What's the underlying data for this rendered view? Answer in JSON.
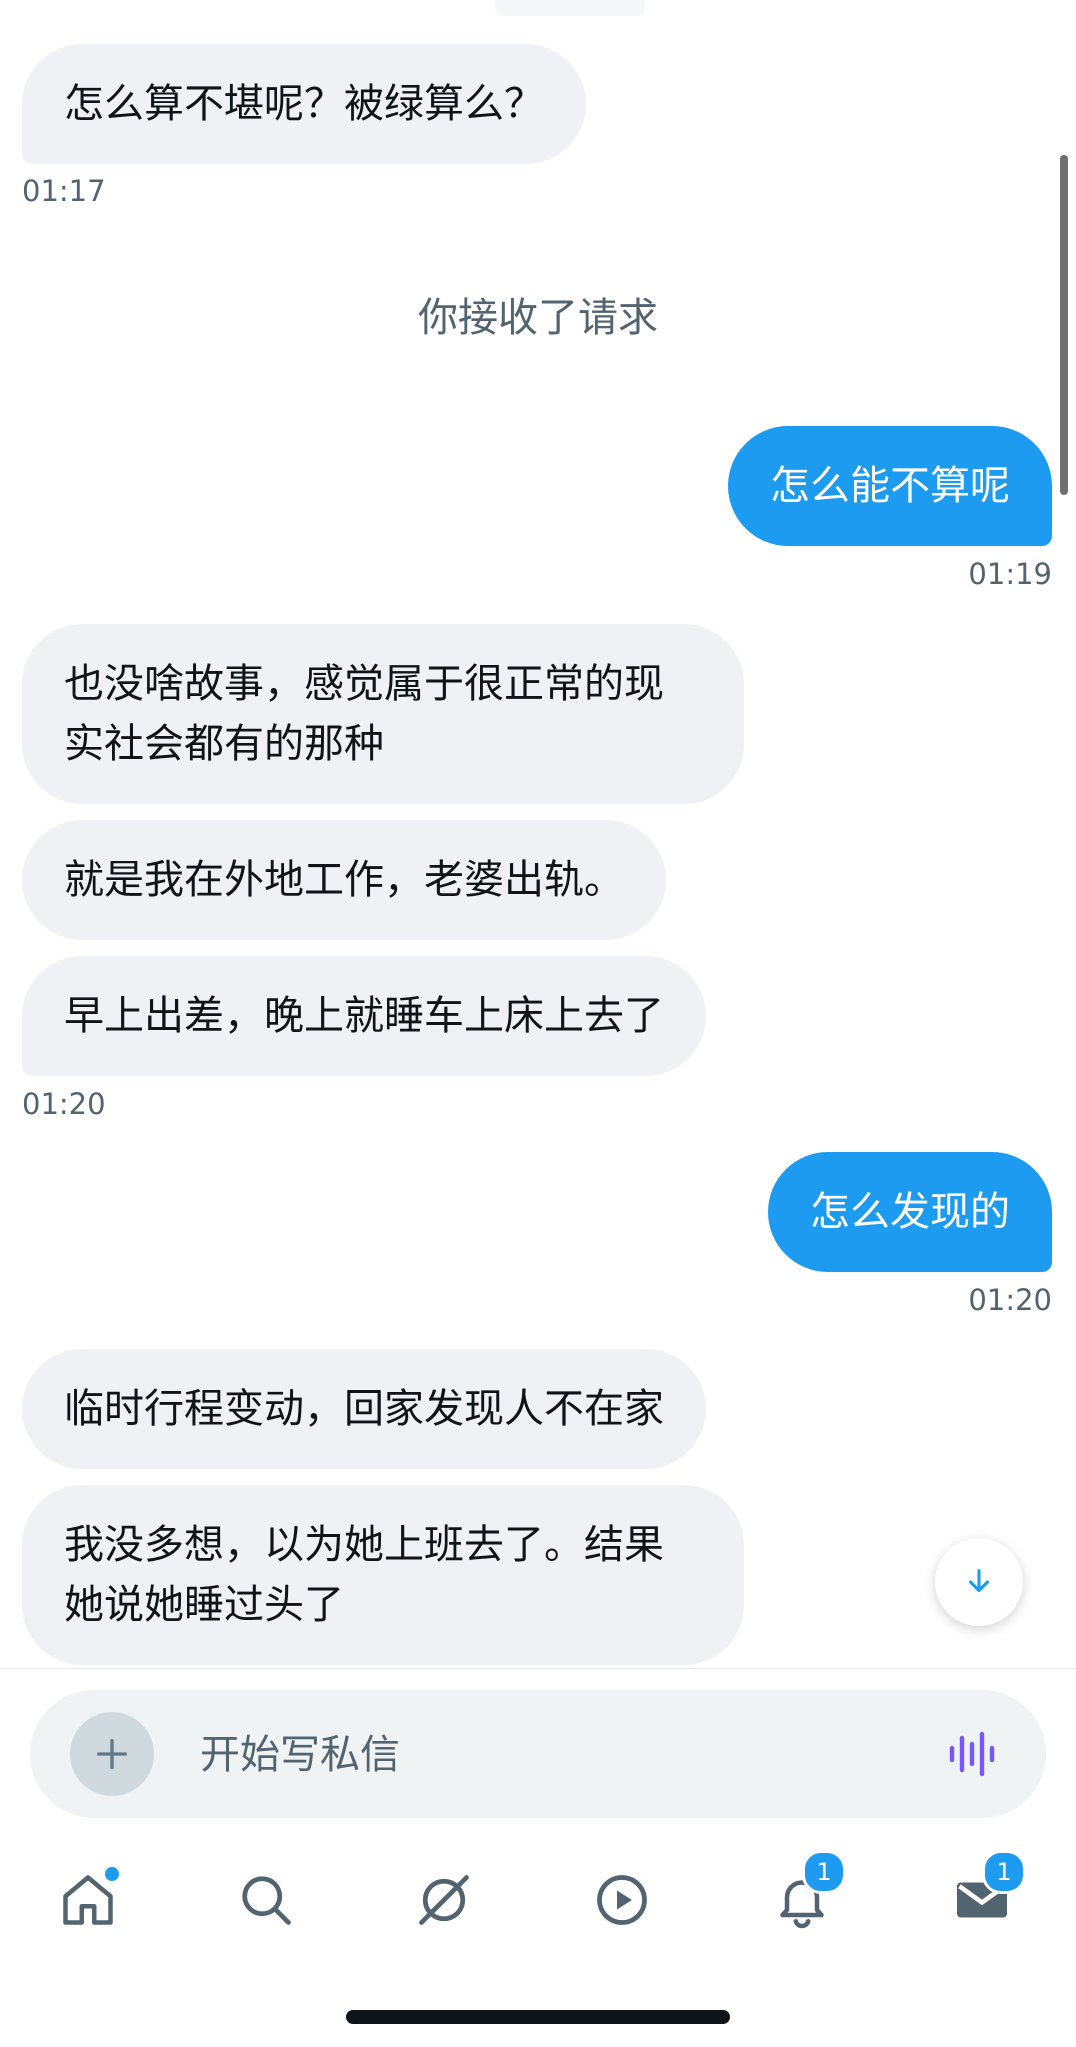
{
  "messages": [
    {
      "text": "怎么算不堪呢？被绿算么？",
      "dir": "in"
    },
    {
      "time": "01:17"
    },
    {
      "system": "你接收了请求"
    },
    {
      "text": "怎么能不算呢",
      "dir": "out"
    },
    {
      "time": "01:19"
    },
    {
      "text": "也没啥故事，感觉属于很正常的现实社会都有的那种",
      "dir": "in"
    },
    {
      "text": "就是我在外地工作，老婆出轨。",
      "dir": "in"
    },
    {
      "text": "早上出差，晚上就睡车上床上去了",
      "dir": "in"
    },
    {
      "time": "01:20"
    },
    {
      "text": "怎么发现的",
      "dir": "out"
    },
    {
      "time": "01:20"
    },
    {
      "text": "临时行程变动，回家发现人不在家",
      "dir": "in"
    },
    {
      "text": "我没多想，以为她上班去了。结果她说她睡过头了",
      "dir": "in"
    }
  ],
  "composer": {
    "placeholder": "开始写私信"
  },
  "tabbar": {
    "notifications_badge": "1",
    "messages_badge": "1"
  },
  "colors": {
    "accent": "#1d9bf0",
    "incoming_bubble": "#eff1f4",
    "voice_icon": "#7856ff"
  }
}
